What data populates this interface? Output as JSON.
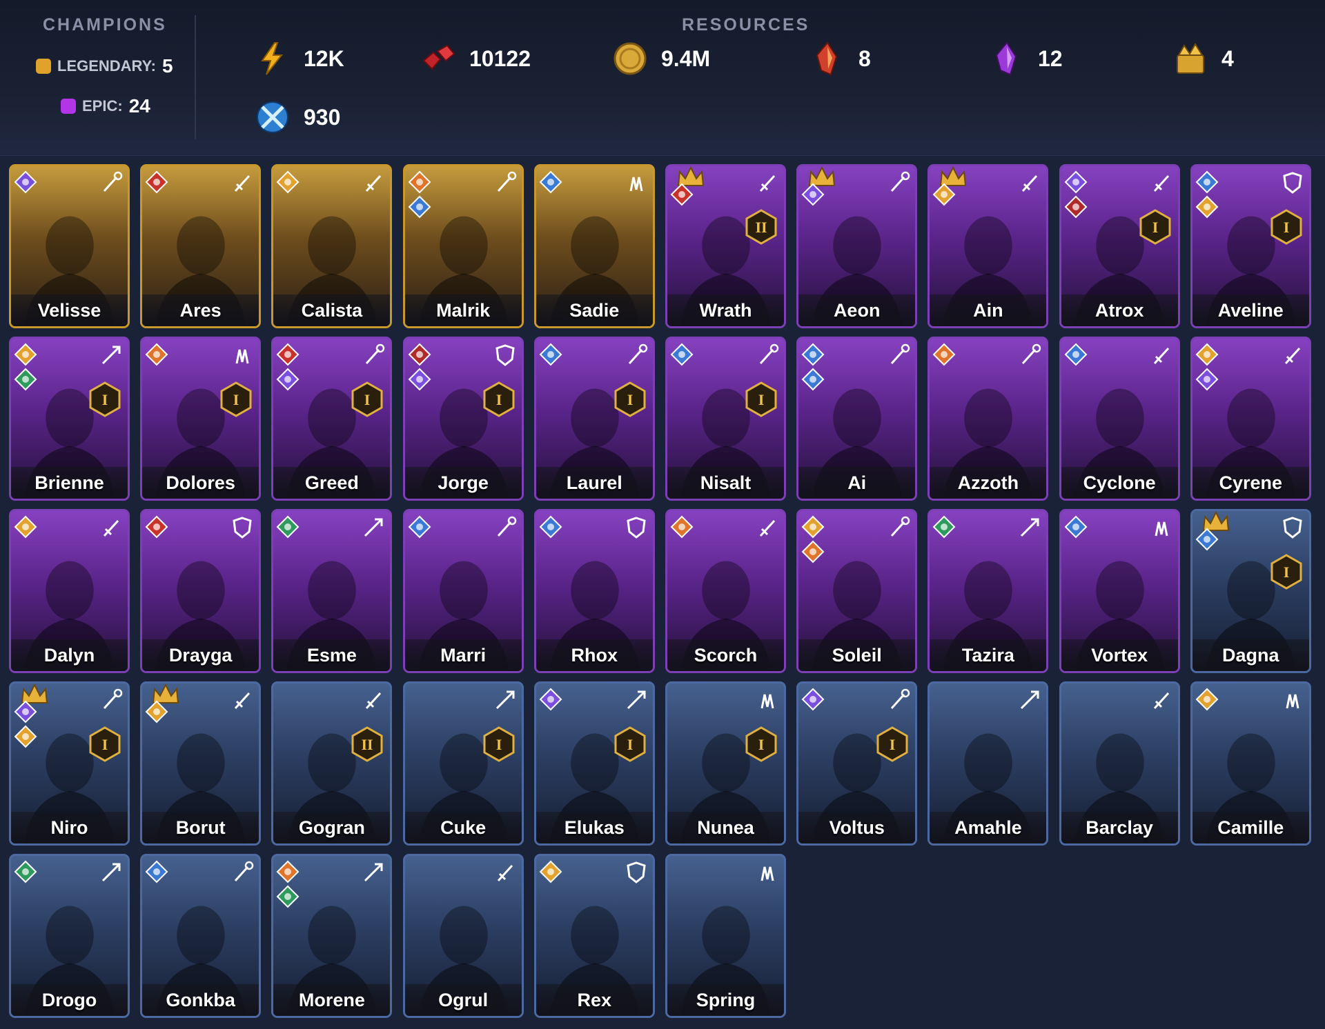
{
  "header": {
    "champions_title": "CHAMPIONS",
    "resources_title": "RESOURCES",
    "legendary_label": "LEGENDARY:",
    "legendary_count": "5",
    "epic_label": "EPIC:",
    "epic_count": "24",
    "colors": {
      "legendary": "#e0a22a",
      "epic": "#b236e8"
    }
  },
  "resources": [
    {
      "icon": "energy-bolt-icon",
      "value": "12K"
    },
    {
      "icon": "ruby-gems-icon",
      "value": "10122"
    },
    {
      "icon": "gold-coin-icon",
      "value": "9.4M"
    },
    {
      "icon": "red-shard-icon",
      "value": "8"
    },
    {
      "icon": "purple-shard-icon",
      "value": "12"
    },
    {
      "icon": "gold-treasure-icon",
      "value": "4"
    },
    {
      "icon": "arena-token-icon",
      "value": "930"
    }
  ],
  "champions": [
    {
      "name": "Velisse",
      "rarity": "legendary",
      "role": "mage-staff-icon",
      "affinity": [
        "spirit"
      ]
    },
    {
      "name": "Ares",
      "rarity": "legendary",
      "role": "sword-icon",
      "affinity": [
        "force"
      ]
    },
    {
      "name": "Calista",
      "rarity": "legendary",
      "role": "sword-icon",
      "affinity": [
        "magic"
      ]
    },
    {
      "name": "Malrik",
      "rarity": "legendary",
      "role": "mage-staff-icon",
      "affinity": [
        "fire",
        "water"
      ]
    },
    {
      "name": "Sadie",
      "rarity": "legendary",
      "role": "support-hands-icon",
      "affinity": [
        "water"
      ]
    },
    {
      "name": "Wrath",
      "rarity": "epic",
      "role": "sword-icon",
      "affinity": [
        "force"
      ],
      "crown": true,
      "rank": "II"
    },
    {
      "name": "Aeon",
      "rarity": "epic",
      "role": "mage-staff-icon",
      "affinity": [
        "spirit"
      ],
      "crown": true
    },
    {
      "name": "Ain",
      "rarity": "epic",
      "role": "sword-icon",
      "affinity": [
        "magic"
      ],
      "crown": true
    },
    {
      "name": "Atrox",
      "rarity": "epic",
      "role": "sword-icon",
      "affinity": [
        "spirit",
        "chaos"
      ],
      "rank": "I"
    },
    {
      "name": "Aveline",
      "rarity": "epic",
      "role": "shield-icon",
      "affinity": [
        "water",
        "magic"
      ],
      "rank": "I"
    },
    {
      "name": "Brienne",
      "rarity": "epic",
      "role": "ranged-icon",
      "affinity": [
        "magic",
        "nature"
      ],
      "rank": "I"
    },
    {
      "name": "Dolores",
      "rarity": "epic",
      "role": "support-hands-icon",
      "affinity": [
        "fire"
      ],
      "rank": "I"
    },
    {
      "name": "Greed",
      "rarity": "epic",
      "role": "mage-staff-icon",
      "affinity": [
        "force",
        "spirit"
      ],
      "rank": "I"
    },
    {
      "name": "Jorge",
      "rarity": "epic",
      "role": "shield-icon",
      "affinity": [
        "chaos",
        "spirit"
      ],
      "rank": "I"
    },
    {
      "name": "Laurel",
      "rarity": "epic",
      "role": "mage-staff-icon",
      "affinity": [
        "water"
      ],
      "rank": "I"
    },
    {
      "name": "Nisalt",
      "rarity": "epic",
      "role": "mage-staff-icon",
      "affinity": [
        "water"
      ],
      "rank": "I"
    },
    {
      "name": "Ai",
      "rarity": "epic",
      "role": "mage-staff-icon",
      "affinity": [
        "water",
        "water"
      ]
    },
    {
      "name": "Azzoth",
      "rarity": "epic",
      "role": "mage-staff-icon",
      "affinity": [
        "fire"
      ]
    },
    {
      "name": "Cyclone",
      "rarity": "epic",
      "role": "sword-icon",
      "affinity": [
        "water"
      ]
    },
    {
      "name": "Cyrene",
      "rarity": "epic",
      "role": "sword-icon",
      "affinity": [
        "magic",
        "spirit"
      ]
    },
    {
      "name": "Dalyn",
      "rarity": "epic",
      "role": "sword-icon",
      "affinity": [
        "magic"
      ]
    },
    {
      "name": "Drayga",
      "rarity": "epic",
      "role": "shield-icon",
      "affinity": [
        "force"
      ]
    },
    {
      "name": "Esme",
      "rarity": "epic",
      "role": "ranged-icon",
      "affinity": [
        "nature"
      ]
    },
    {
      "name": "Marri",
      "rarity": "epic",
      "role": "mage-staff-icon",
      "affinity": [
        "water"
      ]
    },
    {
      "name": "Rhox",
      "rarity": "epic",
      "role": "shield-icon",
      "affinity": [
        "water"
      ]
    },
    {
      "name": "Scorch",
      "rarity": "epic",
      "role": "sword-icon",
      "affinity": [
        "fire"
      ]
    },
    {
      "name": "Soleil",
      "rarity": "epic",
      "role": "mage-staff-icon",
      "affinity": [
        "magic",
        "fire"
      ]
    },
    {
      "name": "Tazira",
      "rarity": "epic",
      "role": "ranged-icon",
      "affinity": [
        "nature"
      ]
    },
    {
      "name": "Vortex",
      "rarity": "epic",
      "role": "support-hands-icon",
      "affinity": [
        "water"
      ]
    },
    {
      "name": "Dagna",
      "rarity": "rare",
      "role": "shield-icon",
      "affinity": [
        "water"
      ],
      "crown": true,
      "rank": "I"
    },
    {
      "name": "Niro",
      "rarity": "rare",
      "role": "mage-staff-icon",
      "affinity": [
        "spirit",
        "magic"
      ],
      "crown": true,
      "rank": "I"
    },
    {
      "name": "Borut",
      "rarity": "rare",
      "role": "sword-icon",
      "affinity": [
        "magic"
      ],
      "crown": true
    },
    {
      "name": "Gogran",
      "rarity": "rare",
      "role": "sword-icon",
      "affinity": [],
      "rank": "II"
    },
    {
      "name": "Cuke",
      "rarity": "rare",
      "role": "ranged-icon",
      "affinity": [],
      "rank": "I"
    },
    {
      "name": "Elukas",
      "rarity": "rare",
      "role": "ranged-icon",
      "affinity": [
        "spirit"
      ],
      "rank": "I"
    },
    {
      "name": "Nunea",
      "rarity": "rare",
      "role": "support-hands-icon",
      "affinity": [],
      "rank": "I"
    },
    {
      "name": "Voltus",
      "rarity": "rare",
      "role": "mage-staff-icon",
      "affinity": [
        "spirit"
      ],
      "rank": "I"
    },
    {
      "name": "Amahle",
      "rarity": "rare",
      "role": "ranged-icon",
      "affinity": []
    },
    {
      "name": "Barclay",
      "rarity": "rare",
      "role": "sword-icon",
      "affinity": []
    },
    {
      "name": "Camille",
      "rarity": "rare",
      "role": "support-hands-icon",
      "affinity": [
        "magic"
      ]
    },
    {
      "name": "Drogo",
      "rarity": "rare",
      "role": "ranged-icon",
      "affinity": [
        "nature"
      ]
    },
    {
      "name": "Gonkba",
      "rarity": "rare",
      "role": "mage-staff-icon",
      "affinity": [
        "water"
      ]
    },
    {
      "name": "Morene",
      "rarity": "rare",
      "role": "ranged-icon",
      "affinity": [
        "fire",
        "nature"
      ]
    },
    {
      "name": "Ogrul",
      "rarity": "rare",
      "role": "sword-icon",
      "affinity": []
    },
    {
      "name": "Rex",
      "rarity": "rare",
      "role": "shield-icon",
      "affinity": [
        "magic"
      ]
    },
    {
      "name": "Spring",
      "rarity": "rare",
      "role": "support-hands-icon",
      "affinity": []
    }
  ]
}
